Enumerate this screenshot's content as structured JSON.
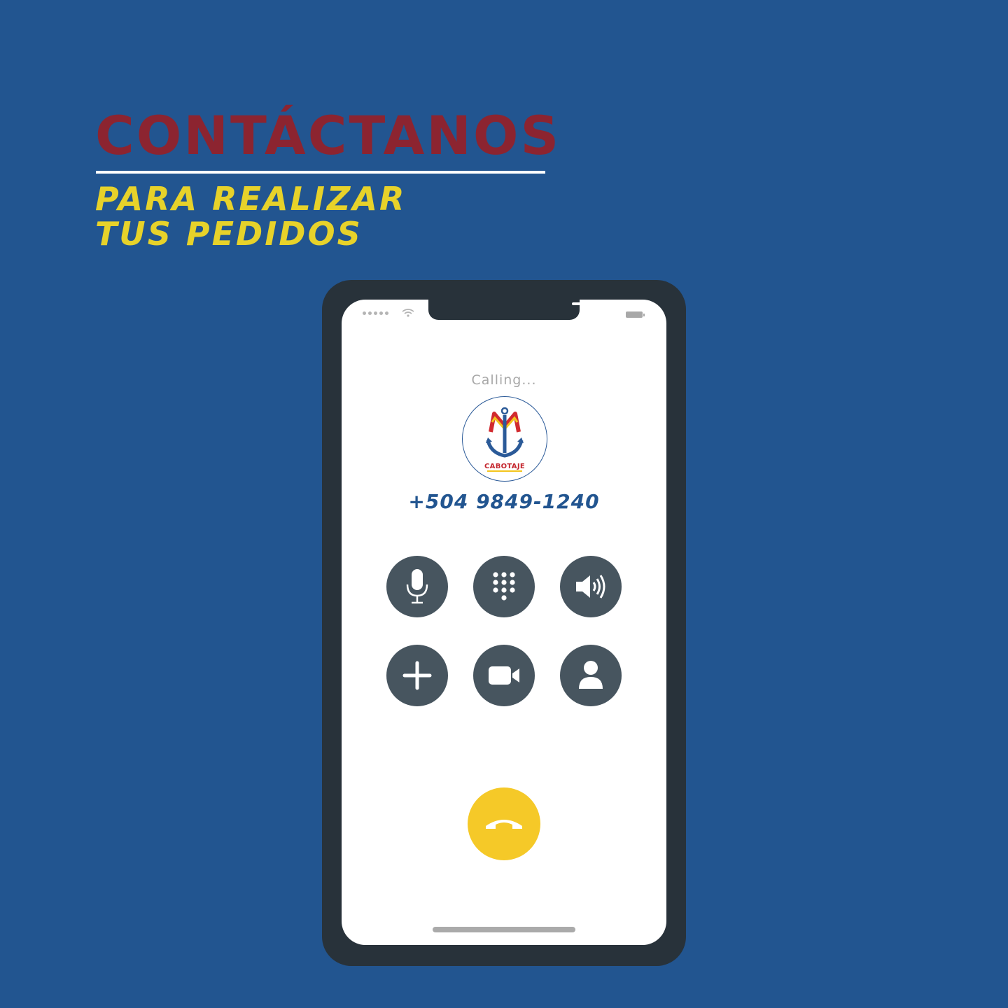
{
  "header": {
    "title": "CONTÁCTANOS",
    "subtitle_line1": "PARA REALIZAR",
    "subtitle_line2": "TUS PEDIDOS"
  },
  "call_screen": {
    "status": "Calling...",
    "contact_logo_text": "CABOTAJE",
    "phone_number": "+504 9849-1240",
    "buttons": [
      "mute",
      "keypad",
      "speaker",
      "add-call",
      "video",
      "contacts"
    ],
    "end_call": "end-call"
  },
  "colors": {
    "background": "#225590",
    "title": "#8c2430",
    "subtitle": "#e7d22a",
    "phone_body": "#28323a",
    "button": "#47555f",
    "end_call": "#f5c928"
  }
}
